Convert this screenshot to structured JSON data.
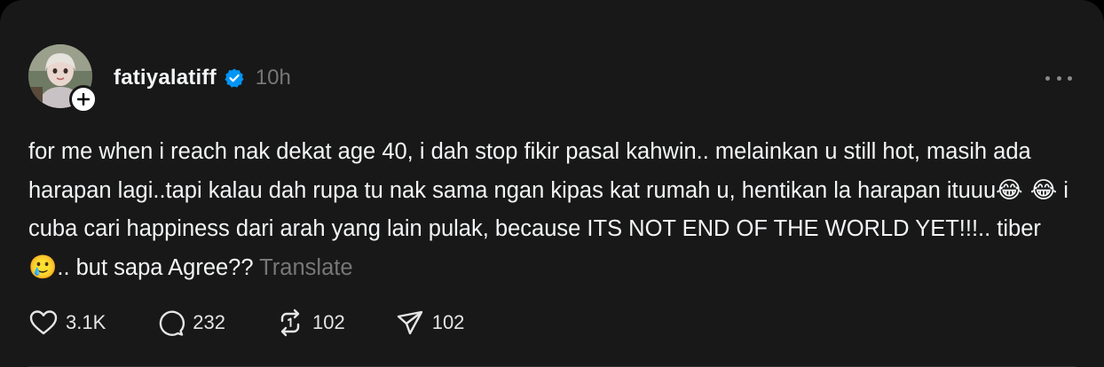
{
  "post": {
    "username": "fatiyalatiff",
    "time": "10h",
    "text_parts": [
      "for me when i reach nak dekat age 40, i dah stop fikir pasal kahwin.. melainkan u still hot, masih ada harapan lagi..tapi kalau dah rupa tu nak sama ngan kipas kat rumah u, hentikan la harapan ituuu",
      "😂 😂",
      " i cuba cari happiness dari arah yang lain pulak, because ITS NOT END OF THE WORLD YET!!!.. tiber",
      "🥲",
      ".. but sapa Agree?? "
    ],
    "translate_label": "Translate"
  },
  "actions": {
    "likes": "3.1K",
    "comments": "232",
    "reposts": "102",
    "shares": "102"
  },
  "colors": {
    "background": "#181818",
    "text": "#f3f5f7",
    "muted": "#777777",
    "verified": "#0095f6"
  },
  "icons": [
    "plus-icon",
    "verified-badge-icon",
    "more-icon",
    "heart-icon",
    "comment-icon",
    "repost-icon",
    "share-icon"
  ]
}
